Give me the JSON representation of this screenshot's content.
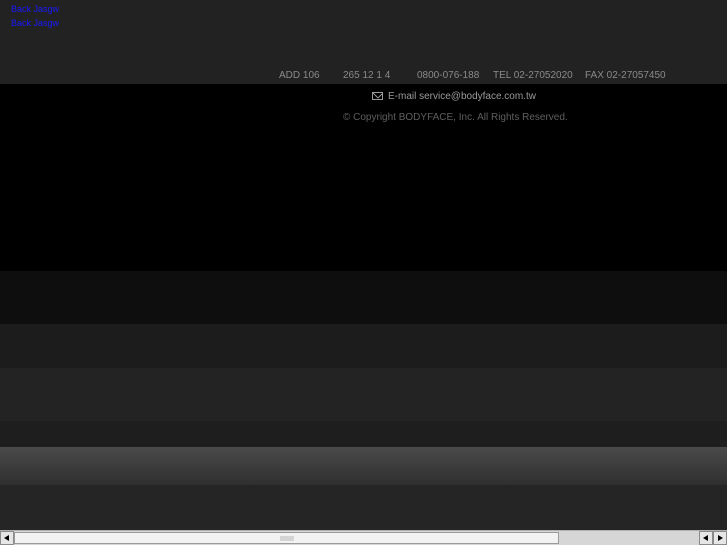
{
  "top_links": [
    "Back Jasgw",
    "Back Jasgw"
  ],
  "info": {
    "add": "ADD 106",
    "address_numbers": "265 12 1 4",
    "toll_free": "0800-076-188",
    "tel": "TEL 02-27052020",
    "fax": "FAX 02-27057450"
  },
  "email": "E-mail service@bodyface.com.tw",
  "copyright": "© Copyright BODYFACE, Inc. All Rights Reserved.",
  "colors": {
    "background": "#222222",
    "footer_band": "#000000",
    "link": "#1a1aff",
    "info_text": "#8a8a8a"
  },
  "icons": [
    "mail-icon",
    "scroll-left-icon",
    "scroll-right-icon"
  ]
}
